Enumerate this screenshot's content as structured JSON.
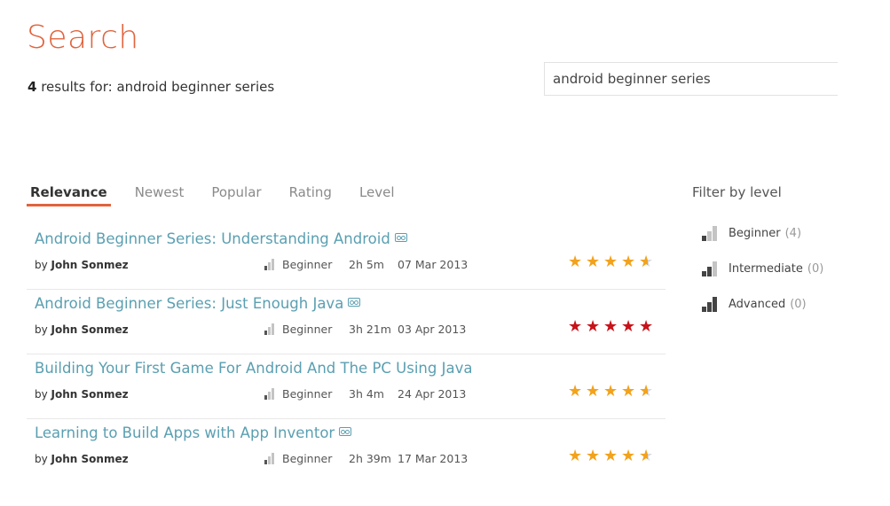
{
  "header": {
    "title": "Search",
    "result_count": "4",
    "results_for_label": "results for:",
    "query": "android beginner series"
  },
  "search": {
    "value": "android beginner series",
    "placeholder": ""
  },
  "sort_tabs": [
    {
      "label": "Relevance",
      "active": true
    },
    {
      "label": "Newest",
      "active": false
    },
    {
      "label": "Popular",
      "active": false
    },
    {
      "label": "Rating",
      "active": false
    },
    {
      "label": "Level",
      "active": false
    }
  ],
  "results": [
    {
      "title": "Android Beginner Series: Understanding Android",
      "cc": true,
      "by": "by",
      "author": "John Sonmez",
      "level": "Beginner",
      "duration": "2h 5m",
      "date": "07 Mar 2013",
      "rating": 4.5,
      "rating_color": "#f3a21c"
    },
    {
      "title": "Android Beginner Series: Just Enough Java",
      "cc": true,
      "by": "by",
      "author": "John Sonmez",
      "level": "Beginner",
      "duration": "3h 21m",
      "date": "03 Apr 2013",
      "rating": 5,
      "rating_color": "#c8121a"
    },
    {
      "title": "Building Your First Game For Android And The PC Using Java",
      "cc": false,
      "by": "by",
      "author": "John Sonmez",
      "level": "Beginner",
      "duration": "3h 4m",
      "date": "24 Apr 2013",
      "rating": 4.5,
      "rating_color": "#f3a21c"
    },
    {
      "title": "Learning to Build Apps with App Inventor",
      "cc": true,
      "by": "by",
      "author": "John Sonmez",
      "level": "Beginner",
      "duration": "2h 39m",
      "date": "17 Mar 2013",
      "rating": 4.5,
      "rating_color": "#f3a21c"
    }
  ],
  "filter": {
    "title": "Filter by level",
    "levels": [
      {
        "label": "Beginner",
        "count": "(4)",
        "bars": 1
      },
      {
        "label": "Intermediate",
        "count": "(0)",
        "bars": 2
      },
      {
        "label": "Advanced",
        "count": "(0)",
        "bars": 3
      }
    ]
  },
  "colors": {
    "accent": "#e0643d",
    "link": "#5a9fb1",
    "star": "#f3a21c",
    "star_top": "#c8121a"
  }
}
